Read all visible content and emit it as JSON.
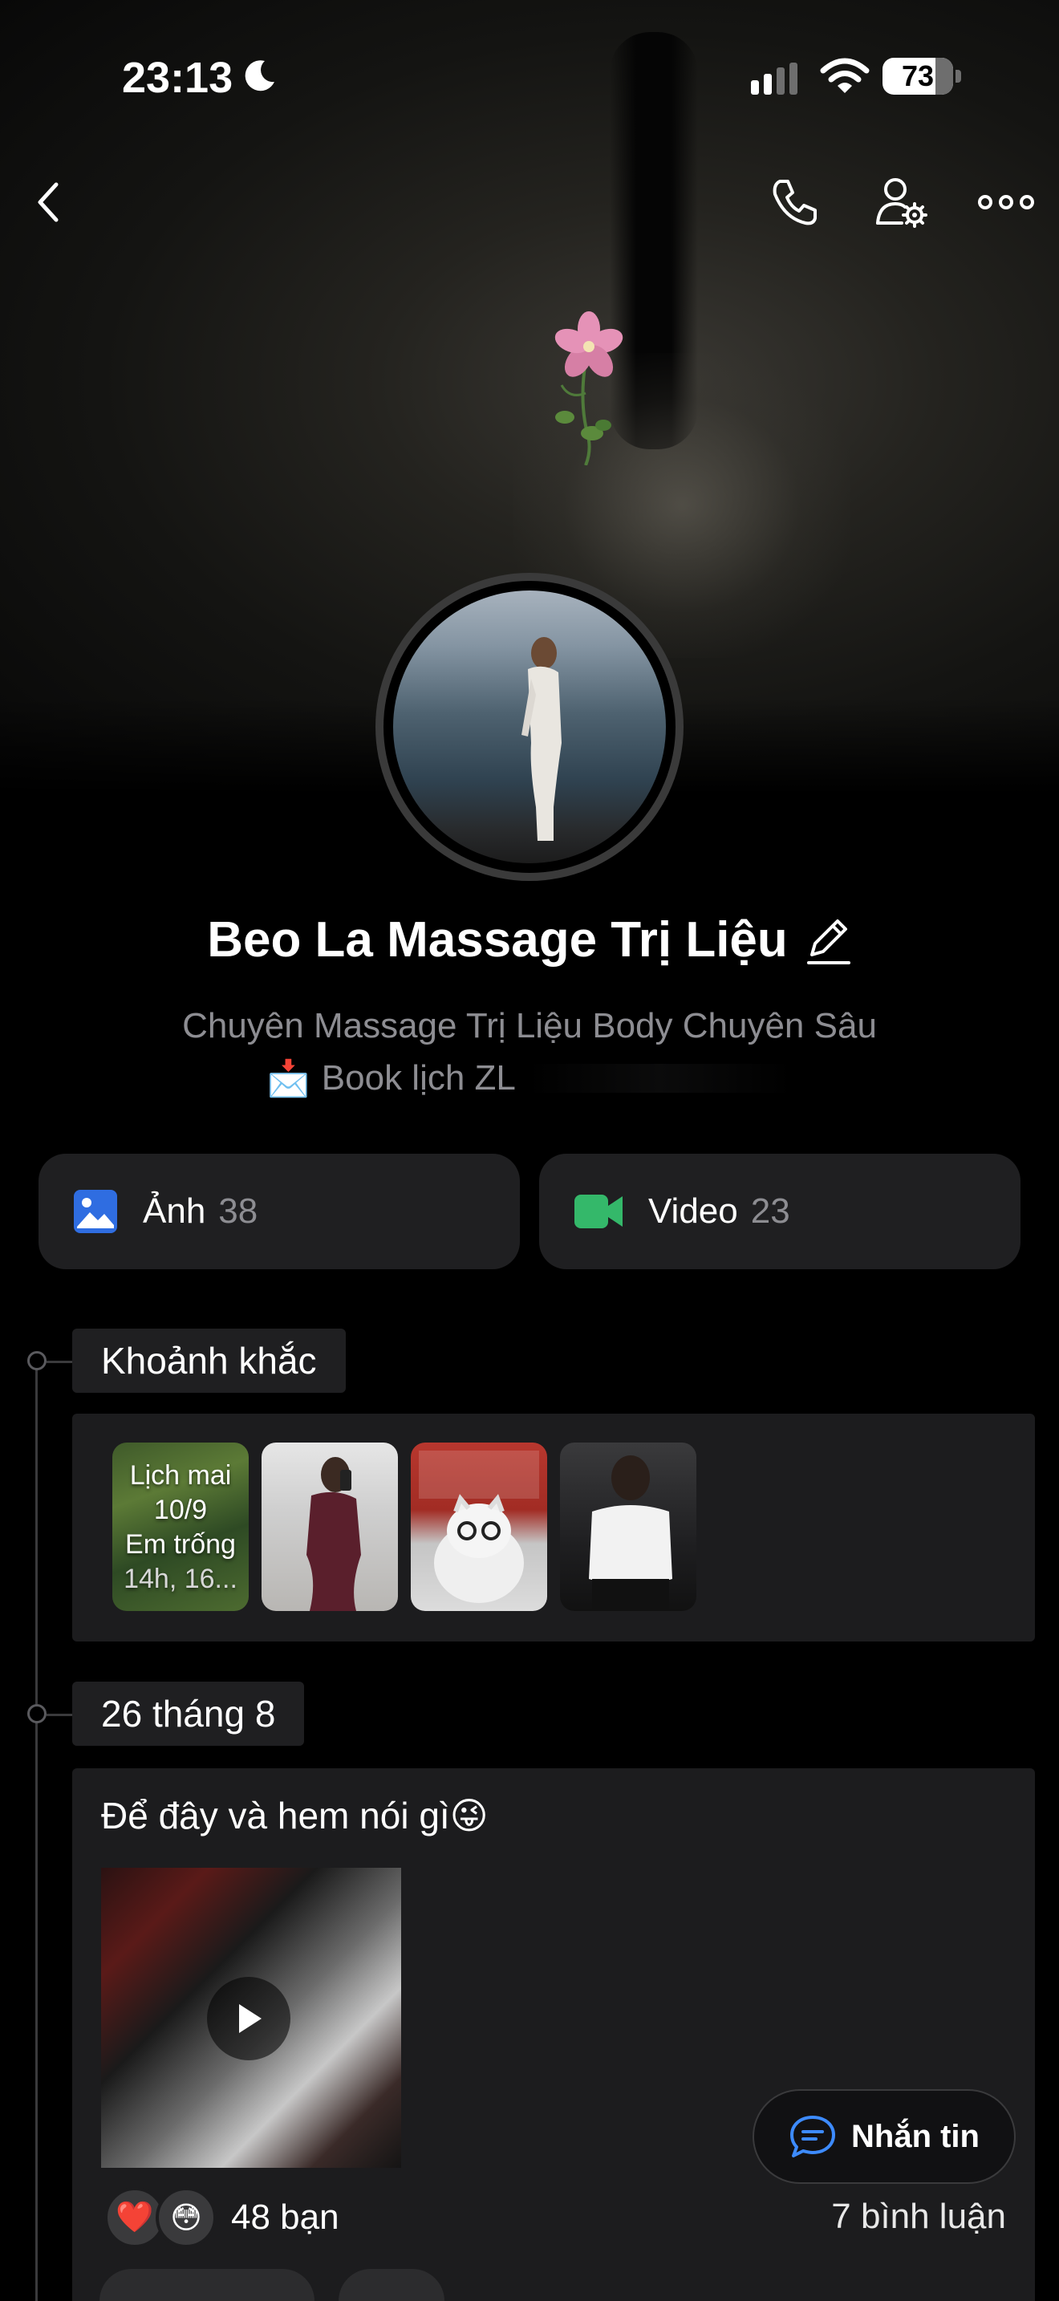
{
  "status_bar": {
    "time": "23:13",
    "battery": "73",
    "icons": [
      "moon-icon",
      "cellular-signal-icon",
      "wifi-icon",
      "battery-icon"
    ]
  },
  "nav": {
    "icons": [
      "back-chevron-icon",
      "phone-icon",
      "user-settings-icon",
      "more-icon"
    ]
  },
  "profile": {
    "name": "Beo La Massage Trị Liệu",
    "bio_line1": "Chuyên Massage Trị Liệu Body Chuyên Sâu",
    "bio_line2_emoji": "📩",
    "bio_line2": "Book lịch ZL"
  },
  "media": {
    "photos_label": "Ảnh",
    "photos_count": "38",
    "videos_label": "Video",
    "videos_count": "23",
    "colors": {
      "photo_icon": "#2f6de1",
      "video_icon": "#34b86a"
    }
  },
  "moments": {
    "label": "Khoảnh khắc",
    "first_thumb_lines": [
      "Lịch mai",
      "10/9",
      "Em trống",
      "14h, 16..."
    ]
  },
  "post": {
    "date_label": "26 tháng 8",
    "text": "Để đây và hem nói gì😜",
    "reactions": [
      "❤️",
      "😳"
    ],
    "reaction_count": "48 bạn",
    "comments": "7 bình luận"
  },
  "chat_button": {
    "label": "Nhắn tin"
  }
}
